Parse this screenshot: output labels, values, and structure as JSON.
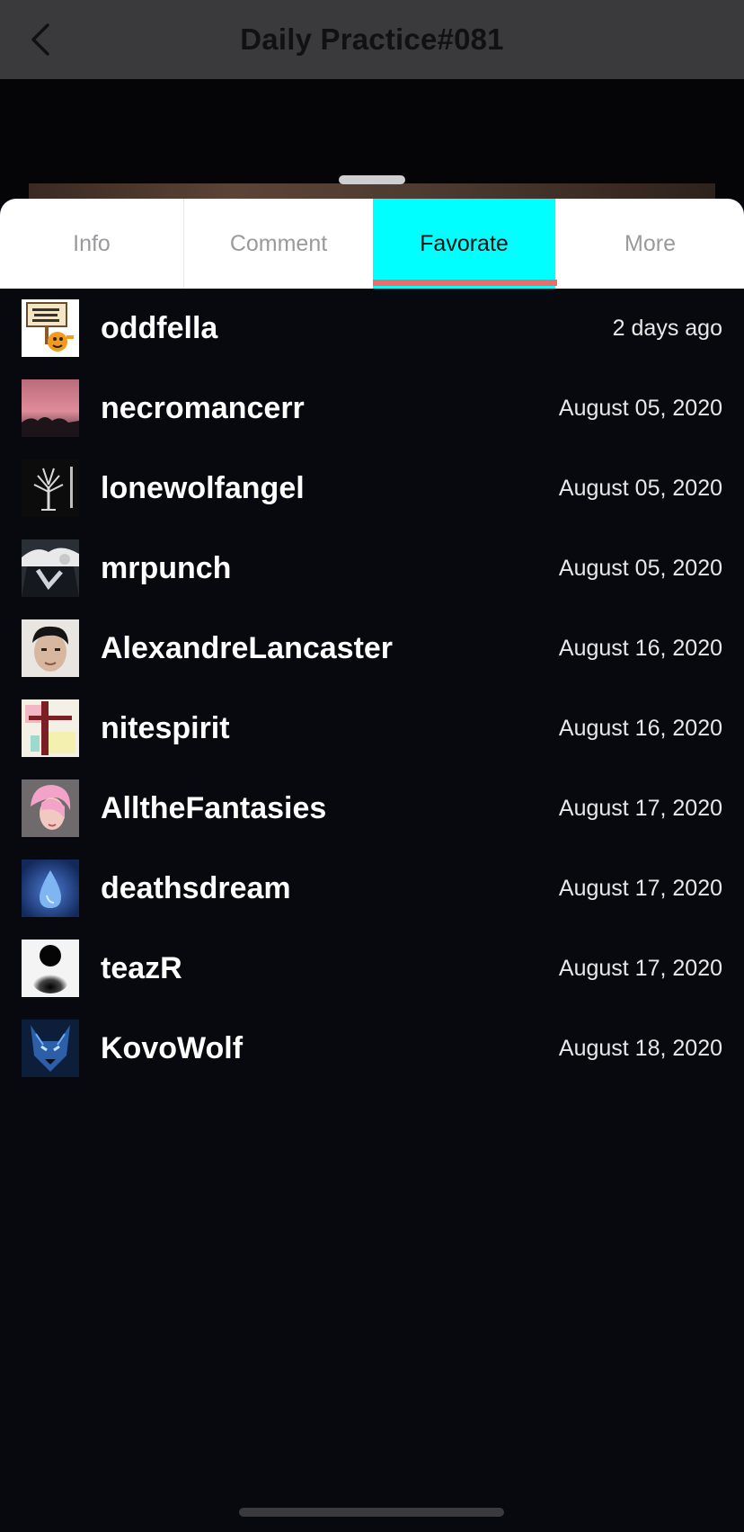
{
  "header": {
    "title": "Daily Practice#081",
    "back_icon": "chevron-left-icon"
  },
  "tabs": [
    {
      "label": "Info",
      "active": false
    },
    {
      "label": "Comment",
      "active": false
    },
    {
      "label": "Favorate",
      "active": true
    },
    {
      "label": "More",
      "active": false
    }
  ],
  "colors": {
    "active_tab_bg": "#00ffff",
    "active_tab_underline": "#f06a6a",
    "header_bg": "#3a3a3c",
    "list_bg": "#08090f"
  },
  "favorites": [
    {
      "username": "oddfella",
      "date": "2 days ago"
    },
    {
      "username": "necromancerr",
      "date": "August 05, 2020"
    },
    {
      "username": "lonewolfangel",
      "date": "August 05, 2020"
    },
    {
      "username": "mrpunch",
      "date": "August 05, 2020"
    },
    {
      "username": "AlexandreLancaster",
      "date": "August 16, 2020"
    },
    {
      "username": "nitespirit",
      "date": "August 16, 2020"
    },
    {
      "username": "AlltheFantasies",
      "date": "August 17, 2020"
    },
    {
      "username": "deathsdream",
      "date": "August 17, 2020"
    },
    {
      "username": "teazR",
      "date": "August 17, 2020"
    },
    {
      "username": "KovoWolf",
      "date": "August 18, 2020"
    }
  ]
}
